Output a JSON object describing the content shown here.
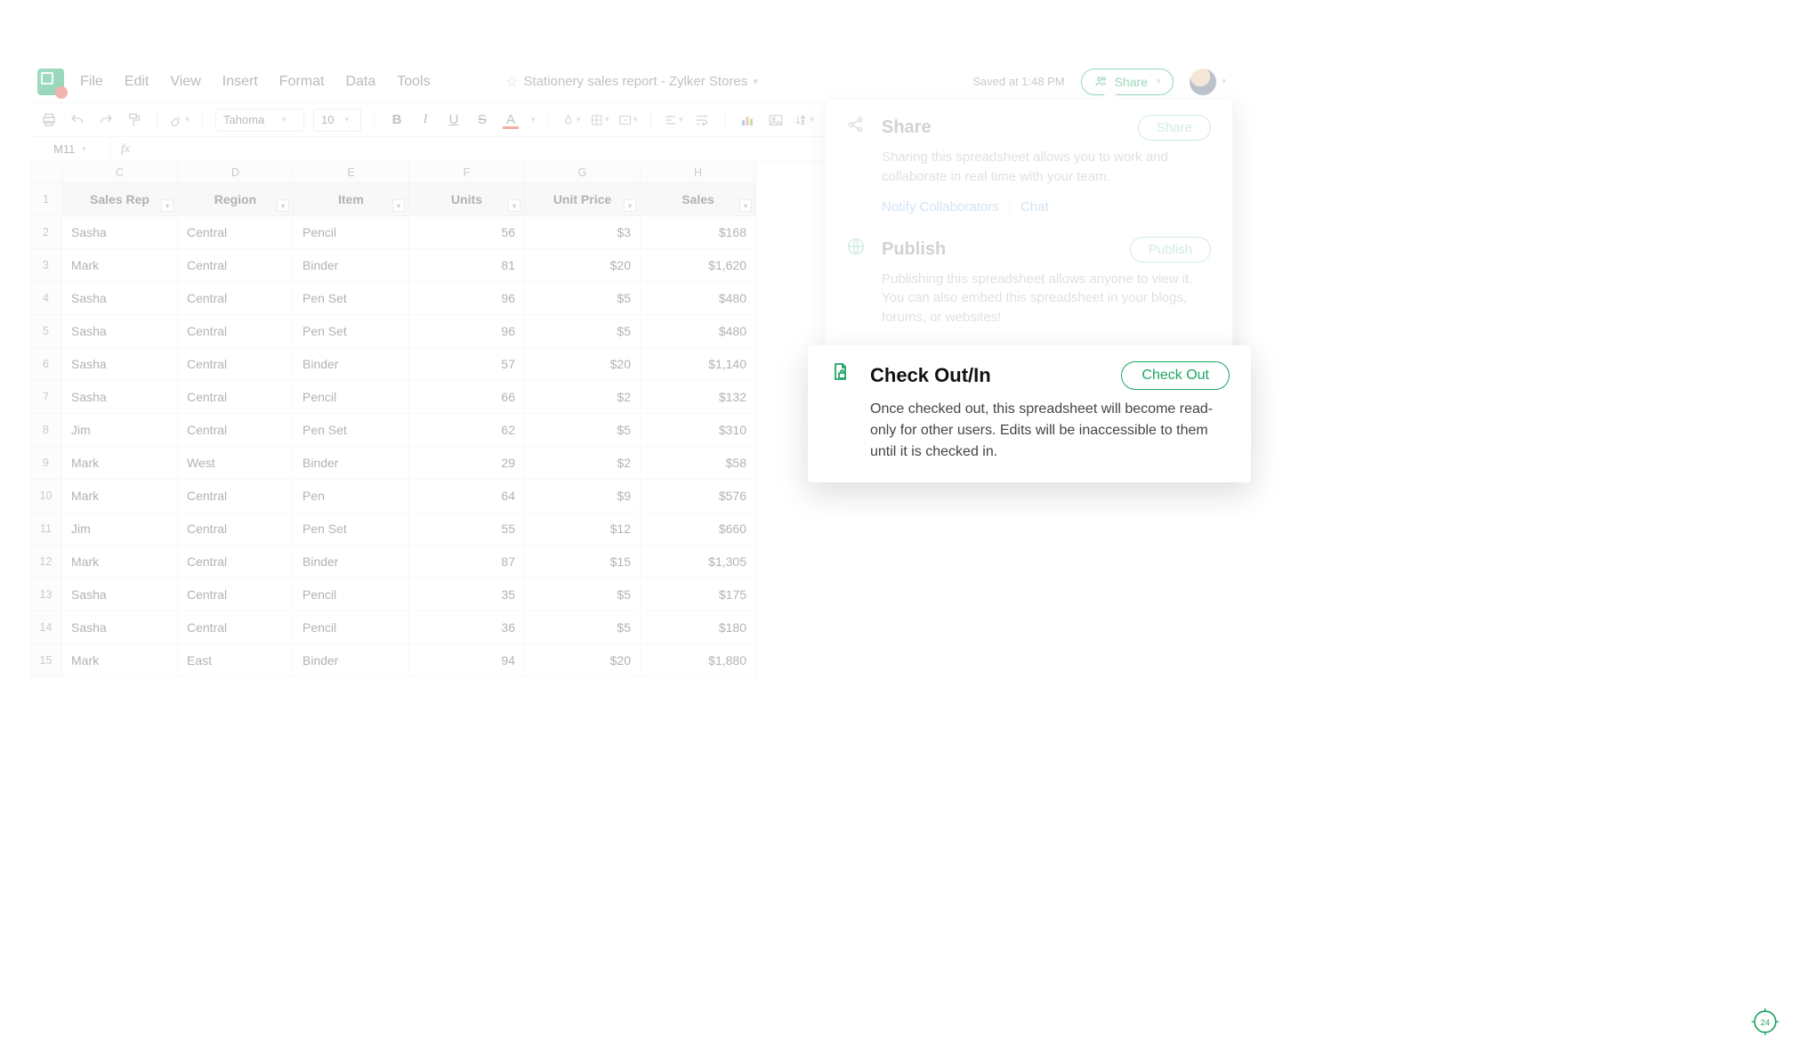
{
  "doc_title": "Stationery sales report - Zylker Stores",
  "saved_status": "Saved at 1:48 PM",
  "menu": {
    "file": "File",
    "edit": "Edit",
    "view": "View",
    "insert": "Insert",
    "format": "Format",
    "data": "Data",
    "tools": "Tools"
  },
  "share_button": "Share",
  "toolbar": {
    "font": "Tahoma",
    "font_size": "10"
  },
  "namebox": "M11",
  "columns": [
    "C",
    "D",
    "E",
    "F",
    "G",
    "H"
  ],
  "headers": {
    "sales_rep": "Sales Rep",
    "region": "Region",
    "item": "Item",
    "units": "Units",
    "unit_price": "Unit Price",
    "sales": "Sales"
  },
  "rows": [
    {
      "n": "1"
    },
    {
      "n": "2",
      "rep": "Sasha",
      "region": "Central",
      "item": "Pencil",
      "units": "56",
      "price": "$3",
      "sales": "$168"
    },
    {
      "n": "3",
      "rep": "Mark",
      "region": "Central",
      "item": "Binder",
      "units": "81",
      "price": "$20",
      "sales": "$1,620"
    },
    {
      "n": "4",
      "rep": "Sasha",
      "region": "Central",
      "item": "Pen Set",
      "units": "96",
      "price": "$5",
      "sales": "$480"
    },
    {
      "n": "5",
      "rep": "Sasha",
      "region": "Central",
      "item": "Pen Set",
      "units": "96",
      "price": "$5",
      "sales": "$480"
    },
    {
      "n": "6",
      "rep": "Sasha",
      "region": "Central",
      "item": "Binder",
      "units": "57",
      "price": "$20",
      "sales": "$1,140"
    },
    {
      "n": "7",
      "rep": "Sasha",
      "region": "Central",
      "item": "Pencil",
      "units": "66",
      "price": "$2",
      "sales": "$132"
    },
    {
      "n": "8",
      "rep": "Jim",
      "region": "Central",
      "item": "Pen Set",
      "units": "62",
      "price": "$5",
      "sales": "$310"
    },
    {
      "n": "9",
      "rep": "Mark",
      "region": "West",
      "item": "Binder",
      "units": "29",
      "price": "$2",
      "sales": "$58"
    },
    {
      "n": "10",
      "rep": "Mark",
      "region": "Central",
      "item": "Pen",
      "units": "64",
      "price": "$9",
      "sales": "$576"
    },
    {
      "n": "11",
      "rep": "Jim",
      "region": "Central",
      "item": "Pen Set",
      "units": "55",
      "price": "$12",
      "sales": "$660"
    },
    {
      "n": "12",
      "rep": "Mark",
      "region": "Central",
      "item": "Binder",
      "units": "87",
      "price": "$15",
      "sales": "$1,305"
    },
    {
      "n": "13",
      "rep": "Sasha",
      "region": "Central",
      "item": "Pencil",
      "units": "35",
      "price": "$5",
      "sales": "$175"
    },
    {
      "n": "14",
      "rep": "Sasha",
      "region": "Central",
      "item": "Pencil",
      "units": "36",
      "price": "$5",
      "sales": "$180"
    },
    {
      "n": "15",
      "rep": "Mark",
      "region": "East",
      "item": "Binder",
      "units": "94",
      "price": "$20",
      "sales": "$1,880"
    }
  ],
  "popover": {
    "share": {
      "title": "Share",
      "btn": "Share",
      "desc": "Sharing this spreadsheet allows you to work and collaborate in real time with your team.",
      "link_notify": "Notify Collaborators",
      "link_chat": "Chat"
    },
    "publish": {
      "title": "Publish",
      "btn": "Publish",
      "desc": "Publishing this spreadsheet allows anyone to view it. You can also embed this spreadsheet in your blogs, forums, or websites!"
    },
    "checkout": {
      "title": "Check Out/In",
      "btn": "Check Out",
      "desc": "Once checked out, this spreadsheet will become read-only for other users. Edits will be inaccessible to them until it is checked in."
    }
  }
}
